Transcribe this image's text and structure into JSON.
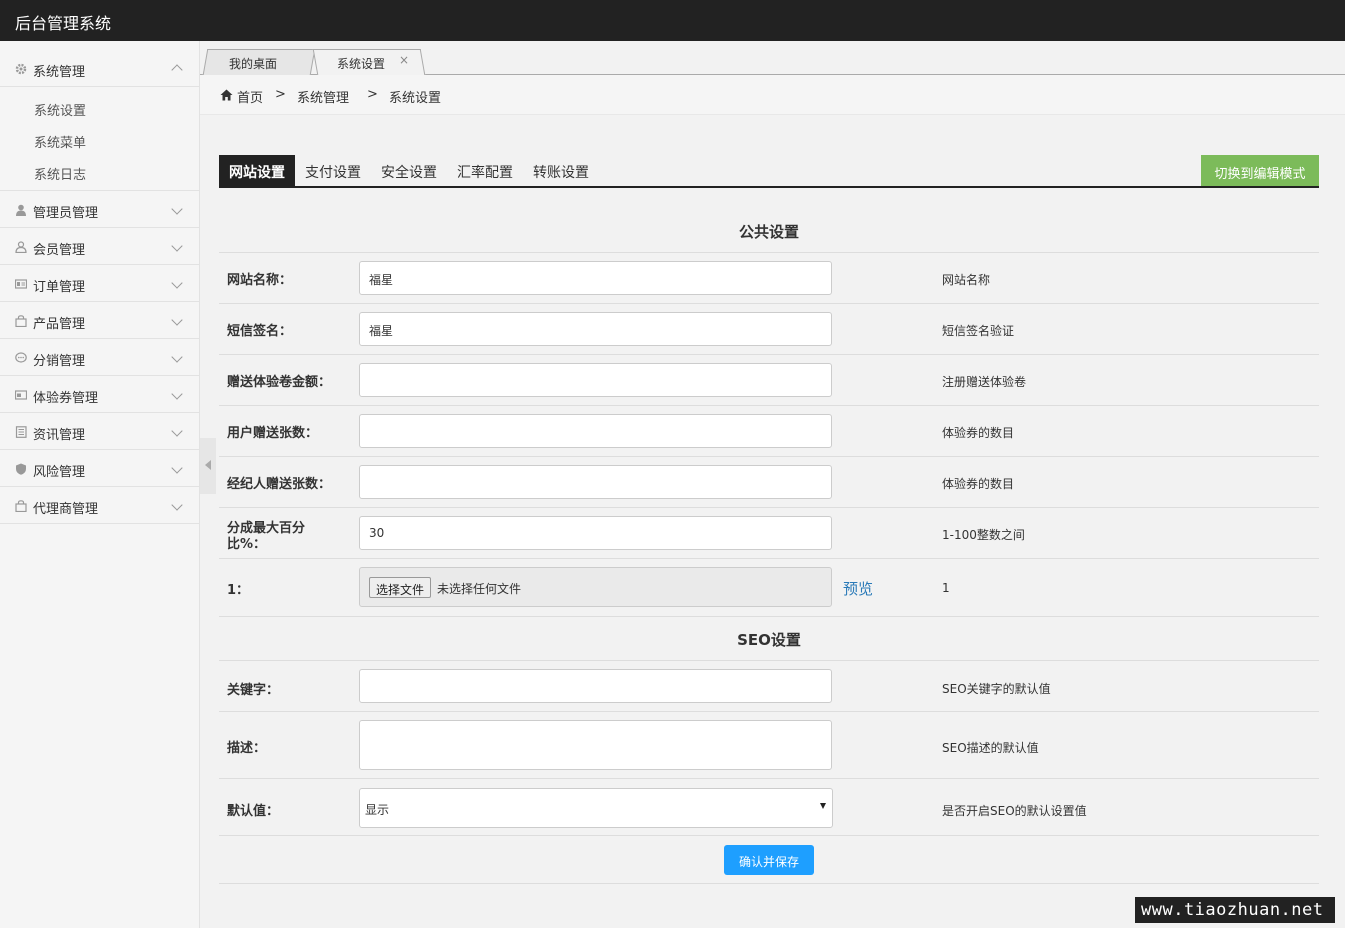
{
  "app": {
    "title": "后台管理系统"
  },
  "sidebar": {
    "groups": [
      {
        "label": "系统管理",
        "icon": "gear-icon",
        "expanded": true,
        "items": [
          "系统设置",
          "系统菜单",
          "系统日志"
        ]
      },
      {
        "label": "管理员管理",
        "icon": "user-icon"
      },
      {
        "label": "会员管理",
        "icon": "member-icon"
      },
      {
        "label": "订单管理",
        "icon": "order-icon"
      },
      {
        "label": "产品管理",
        "icon": "bag-icon"
      },
      {
        "label": "分销管理",
        "icon": "chat-icon"
      },
      {
        "label": "体验券管理",
        "icon": "card-icon"
      },
      {
        "label": "资讯管理",
        "icon": "news-icon"
      },
      {
        "label": "风险管理",
        "icon": "shield-icon"
      },
      {
        "label": "代理商管理",
        "icon": "bag-icon"
      }
    ]
  },
  "tabs": [
    {
      "label": "我的桌面"
    },
    {
      "label": "系统设置",
      "close": "×"
    }
  ],
  "breadcrumb": {
    "home": "首页",
    "sep": ">",
    "level1": "系统管理",
    "level2": "系统设置"
  },
  "subtabs": [
    "网站设置",
    "支付设置",
    "安全设置",
    "汇率配置",
    "转账设置"
  ],
  "mode_button": "切换到编辑模式",
  "sections": {
    "public": "公共设置",
    "seo": "SEO设置"
  },
  "fields": {
    "site_name": {
      "label": "网站名称：",
      "value": "福星",
      "hint": "网站名称"
    },
    "sms_sign": {
      "label": "短信签名：",
      "value": "福星",
      "hint": "短信签名验证"
    },
    "gift_amount": {
      "label": "赠送体验卷金额：",
      "value": "",
      "hint": "注册赠送体验卷"
    },
    "user_gift_count": {
      "label": "用户赠送张数：",
      "value": "",
      "hint": "体验券的数目"
    },
    "agent_gift_count": {
      "label": "经纪人赠送张数：",
      "value": "",
      "hint": "体验券的数目"
    },
    "max_percent": {
      "label_line1": "分成最大百分",
      "label_line2": "比%：",
      "value": "30",
      "hint": "1-100整数之间"
    },
    "file": {
      "label": "1：",
      "button": "选择文件",
      "status": "未选择任何文件",
      "preview": "预览",
      "hint": "1"
    },
    "keywords": {
      "label": "关键字：",
      "value": "",
      "hint": "SEO关键字的默认值"
    },
    "description": {
      "label": "描述：",
      "value": "",
      "hint": "SEO描述的默认值"
    },
    "default": {
      "label": "默认值：",
      "value": "显示",
      "hint": "是否开启SEO的默认设置值"
    }
  },
  "save_button": "确认并保存",
  "watermark": "www.tiaozhuan.net"
}
